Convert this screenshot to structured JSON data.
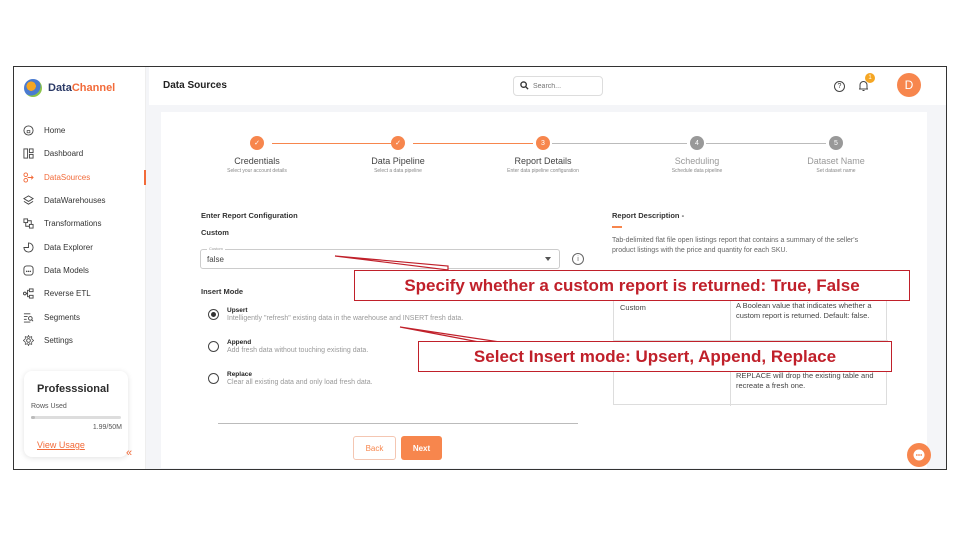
{
  "app": {
    "logo_primary": "Data",
    "logo_accent": "Channel"
  },
  "header": {
    "title": "Data Sources",
    "search_placeholder": "Search...",
    "notification_count": "1",
    "avatar_initial": "D",
    "help_glyph": "?"
  },
  "sidebar": {
    "items": [
      {
        "label": "Home",
        "icon": "home-icon"
      },
      {
        "label": "Dashboard",
        "icon": "dashboard-icon"
      },
      {
        "label": "DataSources",
        "icon": "datasource-icon",
        "active": true
      },
      {
        "label": "DataWarehouses",
        "icon": "warehouse-icon"
      },
      {
        "label": "Transformations",
        "icon": "transform-icon"
      },
      {
        "label": "Data Explorer",
        "icon": "explorer-icon"
      },
      {
        "label": "Data Models",
        "icon": "models-icon"
      },
      {
        "label": "Reverse ETL",
        "icon": "reverse-etl-icon"
      },
      {
        "label": "Segments",
        "icon": "segments-icon"
      },
      {
        "label": "Settings",
        "icon": "settings-icon"
      }
    ],
    "plan": {
      "name": "Professsional",
      "rows_label": "Rows Used",
      "rows_value": "1.99/50M",
      "usage_fraction": 0.04,
      "link": "View Usage"
    },
    "collapse_glyph": "«"
  },
  "steps": [
    {
      "number": "1",
      "label": "Credentials",
      "sub": "Select your account details",
      "state": "done"
    },
    {
      "number": "2",
      "label": "Data Pipeline",
      "sub": "Select a data pipeline",
      "state": "done"
    },
    {
      "number": "3",
      "label": "Report Details",
      "sub": "Enter data pipeline configuration",
      "state": "current"
    },
    {
      "number": "4",
      "label": "Scheduling",
      "sub": "Schedule data pipeline",
      "state": "todo"
    },
    {
      "number": "5",
      "label": "Dataset Name",
      "sub": "Set dataset name",
      "state": "todo"
    }
  ],
  "form": {
    "section_title": "Enter Report Configuration",
    "custom_label": "Custom",
    "custom_select_legend": "Custom",
    "custom_value": "false",
    "insert_mode_label": "Insert Mode",
    "modes": [
      {
        "title": "Upsert",
        "desc": "Intelligently \"refresh\" existing data in the warehouse and INSERT fresh data.",
        "selected": true
      },
      {
        "title": "Append",
        "desc": "Add fresh data without touching existing data.",
        "selected": false
      },
      {
        "title": "Replace",
        "desc": "Clear all existing data and only load fresh data.",
        "selected": false
      }
    ],
    "back_label": "Back",
    "next_label": "Next"
  },
  "description": {
    "title": "Report Description -",
    "text": "Tab-delimited flat file open listings report that contains a summary of the seller's product listings with the price and quantity for each SKU.",
    "table": {
      "row1_key": "Custom",
      "row1_value": "A Boolean value that indicates whether a custom report is returned. Default: false.",
      "row2_value": "REPLACE will drop the existing table and recreate a fresh one."
    }
  },
  "callouts": {
    "custom": "Specify whether a custom report is returned: True, False",
    "insert": "Select Insert mode: Upsert, Append, Replace"
  },
  "colors": {
    "accent": "#f7864d",
    "callout": "#c0202a"
  }
}
